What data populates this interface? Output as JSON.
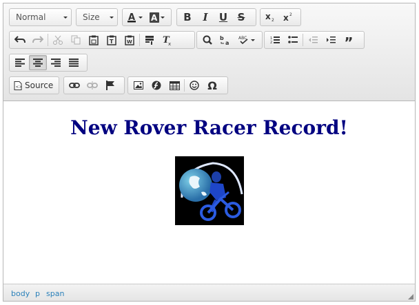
{
  "toolbar": {
    "format_combo": "Normal",
    "size_combo": "Size",
    "source_label": "Source",
    "icons": [
      "text-color-icon",
      "background-color-icon",
      "bold-icon",
      "italic-icon",
      "underline-icon",
      "strikethrough-icon",
      "subscript-icon",
      "superscript-icon",
      "undo-icon",
      "redo-icon",
      "cut-icon",
      "copy-icon",
      "paste-icon",
      "paste-text-icon",
      "paste-word-icon",
      "select-all-icon",
      "remove-format-icon",
      "find-icon",
      "replace-icon",
      "spellcheck-icon",
      "numbered-list-icon",
      "bulleted-list-icon",
      "decrease-indent-icon",
      "increase-indent-icon",
      "blockquote-icon",
      "align-left-icon",
      "align-center-icon",
      "align-right-icon",
      "justify-icon",
      "source-icon",
      "link-icon",
      "unlink-icon",
      "anchor-icon",
      "image-icon",
      "flash-icon",
      "table-icon",
      "smiley-icon",
      "special-char-icon"
    ]
  },
  "content": {
    "heading": "New Rover Racer Record!"
  },
  "statusbar": {
    "path": [
      "body",
      "p",
      "span"
    ]
  },
  "colors": {
    "heading": "#000080",
    "path_link": "#2a80b9"
  }
}
